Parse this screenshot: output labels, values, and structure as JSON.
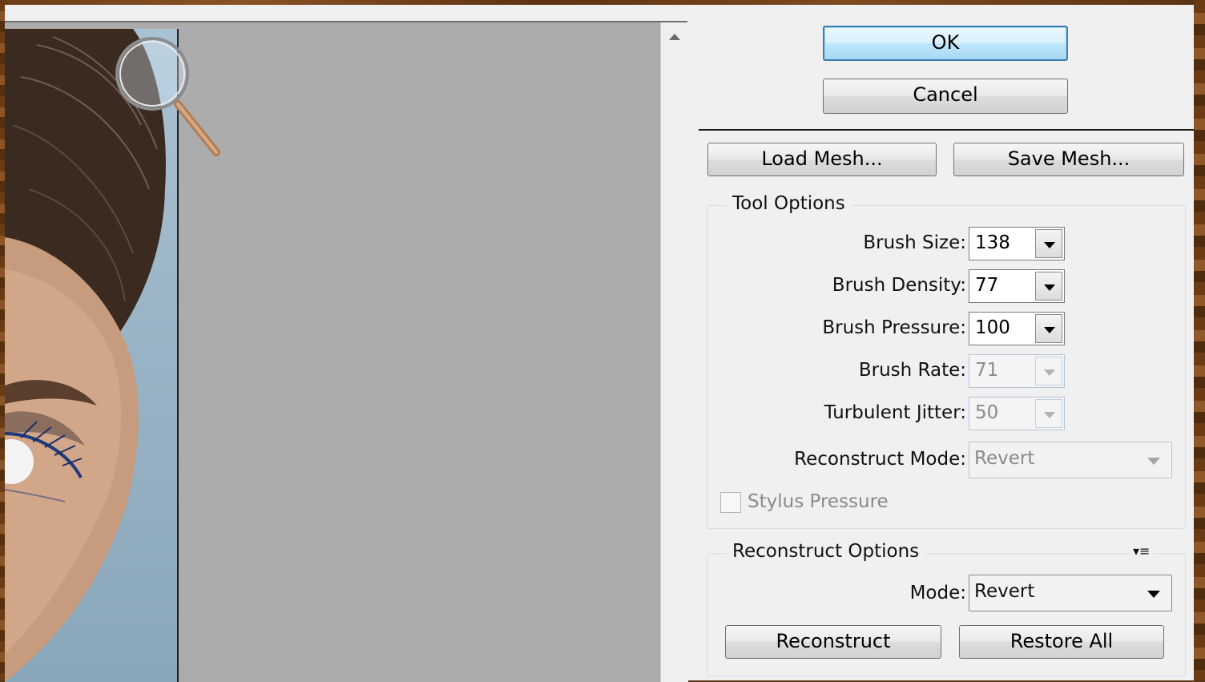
{
  "buttons": {
    "ok": "OK",
    "cancel": "Cancel",
    "load_mesh": "Load Mesh...",
    "save_mesh": "Save Mesh..."
  },
  "tool_options": {
    "title": "Tool Options",
    "brush_size": {
      "label": "Brush Size:",
      "value": "138"
    },
    "brush_density": {
      "label": "Brush Density:",
      "value": "77"
    },
    "brush_pressure": {
      "label": "Brush Pressure:",
      "value": "100"
    },
    "brush_rate": {
      "label": "Brush Rate:",
      "value": "71",
      "disabled": true
    },
    "turbulent_jitter": {
      "label": "Turbulent Jitter:",
      "value": "50",
      "disabled": true
    },
    "reconstruct_mode": {
      "label": "Reconstruct Mode:",
      "value": "Revert",
      "disabled": true
    },
    "stylus_pressure": {
      "label": "Stylus Pressure",
      "checked": false,
      "disabled": true
    }
  },
  "reconstruct_options": {
    "title": "Reconstruct Options",
    "mode": {
      "label": "Mode:",
      "value": "Revert"
    },
    "reconstruct_button": "Reconstruct",
    "restore_all_button": "Restore All"
  },
  "icons": {
    "zoom_cursor": "magnifier-icon",
    "scroll_up": "scroll-up-arrow-icon",
    "panel_menu": "panel-menu-icon"
  },
  "colors": {
    "dialog_bg": "#f0f0f0",
    "preview_bg": "#acacac",
    "default_button_border": "#3c7fb1"
  }
}
